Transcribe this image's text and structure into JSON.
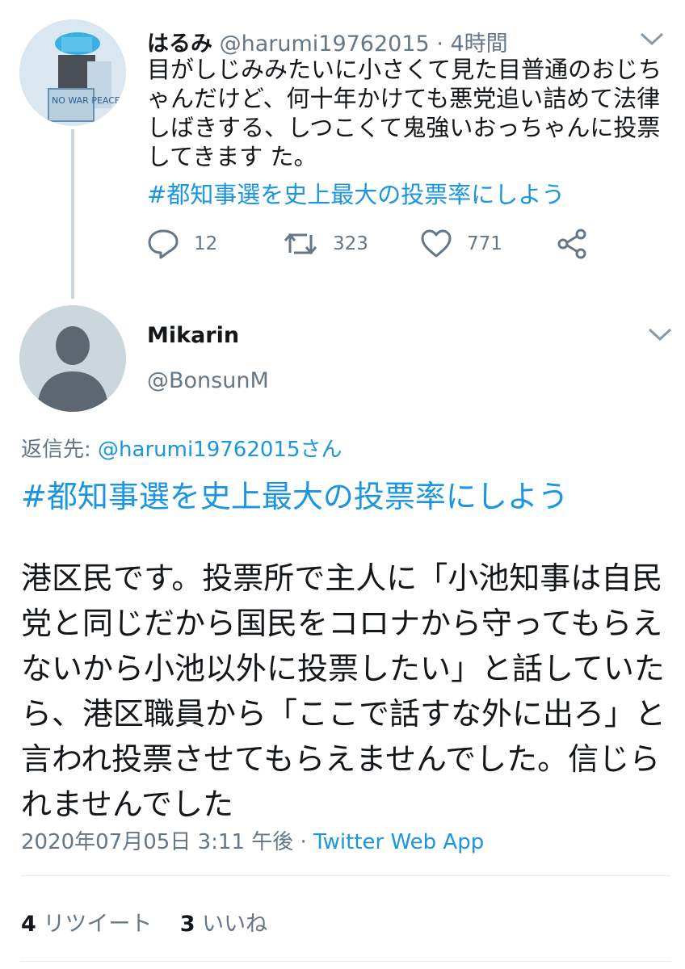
{
  "tweet1": {
    "name": "はるみ",
    "handle": "@harumi19762015",
    "separator": "·",
    "time": "4時間",
    "text": "目がしじみみたいに小さくて見た目普通のおじちゃんだけど、何十年かけても悪党追い詰めて法律しばきする、しつこくて鬼強いおっちゃんに投票してきます た。",
    "hashtag": "#都知事選を史上最大の投票率にしよう",
    "avatar_text": "NO WAR PEACE",
    "replies": "12",
    "retweets": "323",
    "likes": "771"
  },
  "tweet2": {
    "name": "Mikarin",
    "handle": "@BonsunM",
    "reply_prefix": "返信先:",
    "reply_to": "@harumi19762015さん",
    "hashtag": "#都知事選を史上最大の投票率にしよう",
    "text": "港区民です。投票所で主人に「小池知事は自民党と同じだから国民をコロナから守ってもらえないから小池以外に投票したい」と話していたら、港区職員から「ここで話すな外に出ろ」と言われ投票させてもらえませんでした。信じられませんでした",
    "date": "2020年07月05日 3:11 午後",
    "meta_sep": "·",
    "client": "Twitter Web App",
    "retweet_count": "4",
    "retweet_label": "リツイート",
    "like_count": "3",
    "like_label": "いいね"
  },
  "icons": [
    "chevron-down-icon",
    "reply-icon",
    "retweet-icon",
    "like-icon",
    "share-icon",
    "default-avatar-icon"
  ],
  "colors": {
    "link": "#1b95e0",
    "secondary": "#657786",
    "line": "#ccd6dd",
    "text": "#14171a"
  }
}
